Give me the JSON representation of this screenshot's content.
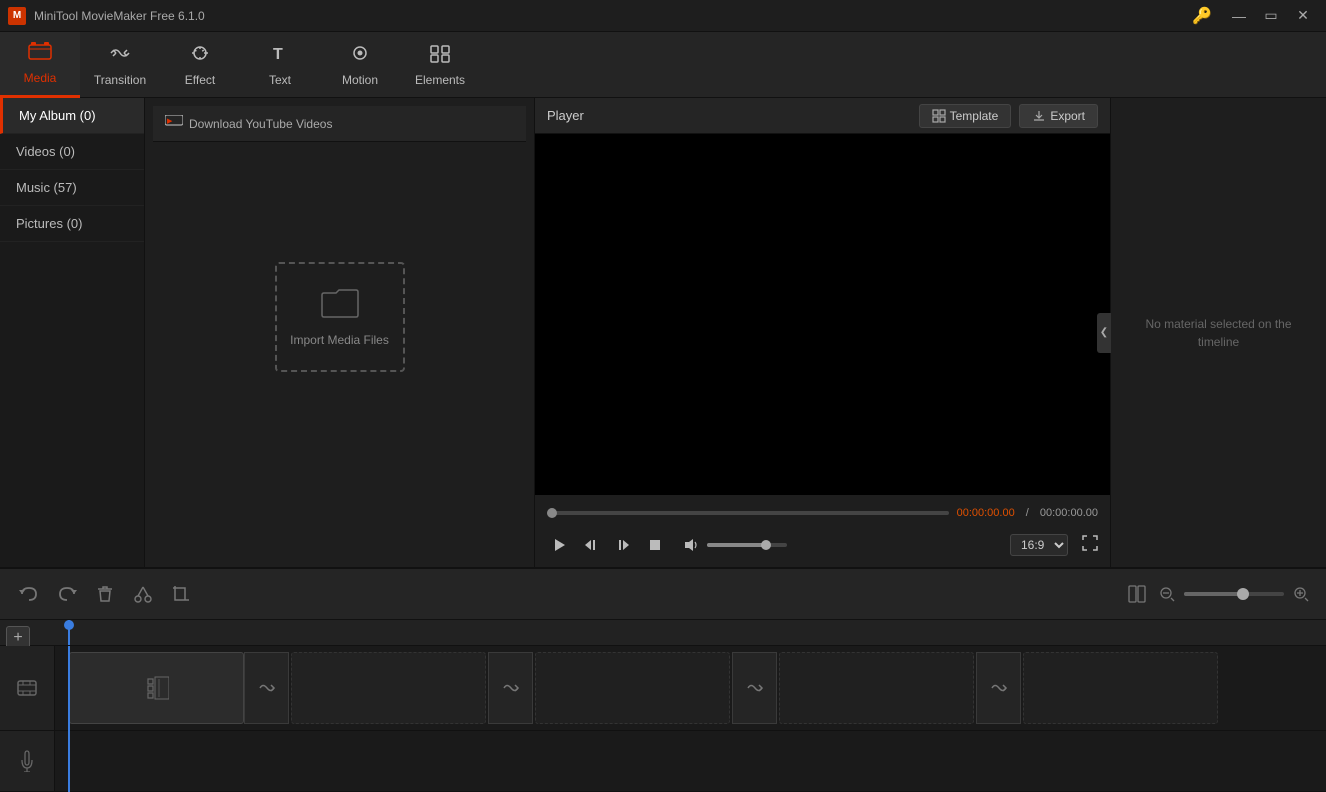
{
  "app": {
    "title": "MiniTool MovieMaker Free 6.1.0",
    "icon_label": "M"
  },
  "win_controls": {
    "key_icon": "🔑",
    "minimize": "—",
    "restore": "❐",
    "close": "✕"
  },
  "toolbar": {
    "items": [
      {
        "id": "media",
        "label": "Media",
        "icon": "📁",
        "active": true
      },
      {
        "id": "transition",
        "label": "Transition",
        "icon": "⇄"
      },
      {
        "id": "effect",
        "label": "Effect",
        "icon": "✦"
      },
      {
        "id": "text",
        "label": "Text",
        "icon": "T"
      },
      {
        "id": "motion",
        "label": "Motion",
        "icon": "◉"
      },
      {
        "id": "elements",
        "label": "Elements",
        "icon": "⊞"
      }
    ]
  },
  "sidebar": {
    "items": [
      {
        "id": "album",
        "label": "My Album (0)",
        "active": true
      },
      {
        "id": "videos",
        "label": "Videos (0)"
      },
      {
        "id": "music",
        "label": "Music (57)"
      },
      {
        "id": "pictures",
        "label": "Pictures (0)"
      }
    ]
  },
  "media": {
    "download_bar_label": "Download YouTube Videos",
    "import_label": "Import Media Files"
  },
  "player": {
    "label": "Player",
    "template_btn": "Template",
    "export_btn": "Export",
    "time_current": "00:00:00.00",
    "time_separator": "/",
    "time_total": "00:00:00.00",
    "aspect_ratio": "16:9",
    "volume": 70
  },
  "properties": {
    "no_material_text": "No material selected on the timeline"
  },
  "bottom_toolbar": {
    "undo_label": "Undo",
    "redo_label": "Redo",
    "delete_label": "Delete",
    "cut_label": "Cut",
    "crop_label": "Crop"
  },
  "timeline": {
    "video_track_icon": "🎬",
    "audio_track_icon": "🎵",
    "add_track_icon": "+"
  }
}
